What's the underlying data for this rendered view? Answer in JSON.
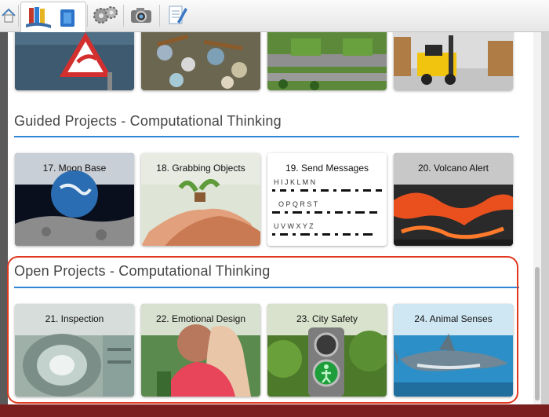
{
  "toolbar": {
    "buttons": [
      {
        "name": "home-icon"
      },
      {
        "name": "library-books-icon"
      },
      {
        "name": "settings-gears-icon"
      },
      {
        "name": "camera-icon"
      },
      {
        "name": "notes-pencil-icon"
      }
    ]
  },
  "sections": {
    "guided": {
      "title": "Guided Projects - Computational Thinking"
    },
    "open": {
      "title": "Open Projects - Computational Thinking"
    }
  },
  "guided_cards": [
    {
      "title": "17. Moon Base"
    },
    {
      "title": "18. Grabbing Objects"
    },
    {
      "title": "19. Send Messages"
    },
    {
      "title": "20. Volcano Alert"
    }
  ],
  "open_cards": [
    {
      "title": "21. Inspection"
    },
    {
      "title": "22. Emotional Design"
    },
    {
      "title": "23. City Safety"
    },
    {
      "title": "24. Animal Senses"
    }
  ],
  "morse_rows": [
    "H  I  J  K  L  M  N",
    "O  P  Q  R  S  T",
    "U  V  W  X  Y  Z"
  ],
  "colors": {
    "accent": "#2f86d6",
    "highlight": "#e0381f"
  }
}
